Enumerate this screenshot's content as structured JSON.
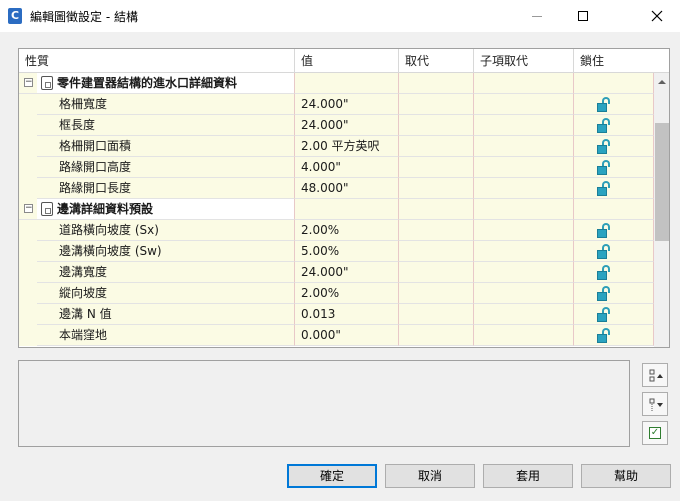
{
  "window": {
    "title": "編輯圖徵設定 - 結構",
    "app_icon_letter": "C"
  },
  "grid": {
    "columns": [
      "性質",
      "值",
      "取代",
      "子項取代",
      "鎖住"
    ],
    "rows": [
      {
        "type": "category",
        "label": "零件建置器結構的進水口詳細資料",
        "value": ""
      },
      {
        "type": "item",
        "label": "格柵寬度",
        "value": "24.000\""
      },
      {
        "type": "item",
        "label": "框長度",
        "value": "24.000\""
      },
      {
        "type": "item",
        "label": "格柵開口面積",
        "value": "2.00 平方英呎"
      },
      {
        "type": "item",
        "label": "路緣開口高度",
        "value": "4.000\""
      },
      {
        "type": "item",
        "label": "路緣開口長度",
        "value": "48.000\""
      },
      {
        "type": "category",
        "label": "邊溝詳細資料預設",
        "value": ""
      },
      {
        "type": "item",
        "label": "道路橫向坡度 (Sx)",
        "value": "2.00%"
      },
      {
        "type": "item",
        "label": "邊溝橫向坡度 (Sw)",
        "value": "5.00%"
      },
      {
        "type": "item",
        "label": "邊溝寬度",
        "value": "24.000\""
      },
      {
        "type": "item",
        "label": "縱向坡度",
        "value": "2.00%"
      },
      {
        "type": "item",
        "label": "邊溝 N 值",
        "value": "0.013"
      },
      {
        "type": "item",
        "label": "本端窪地",
        "value": "0.000\""
      }
    ]
  },
  "buttons": {
    "ok": "確定",
    "cancel": "取消",
    "apply": "套用",
    "help": "幫助"
  },
  "side_buttons": [
    "expand-all",
    "collapse-all",
    "check"
  ],
  "colors": {
    "row_bg": "#fbfbe4",
    "lock_icon": "#2aa3c0",
    "primary_border": "#0078d7"
  }
}
